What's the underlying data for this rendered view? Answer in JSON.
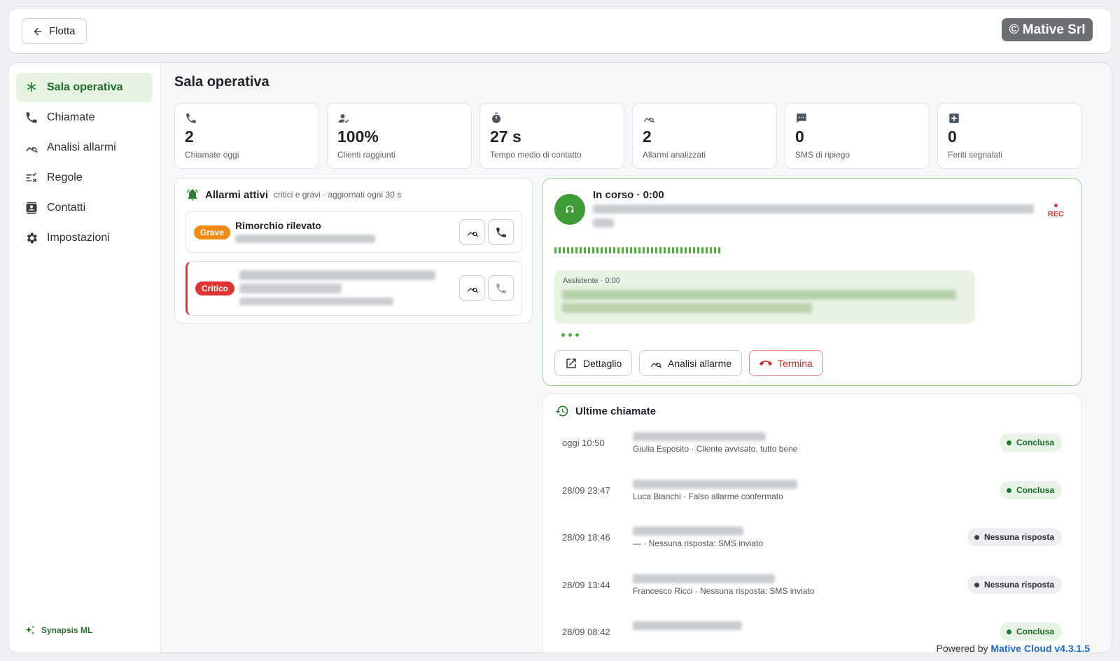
{
  "topbar": {
    "back_label": "Flotta",
    "brand_badge": "© Mative Srl"
  },
  "sidebar": {
    "items": [
      {
        "label": "Sala operativa",
        "icon": "asterisk-icon",
        "active": true
      },
      {
        "label": "Chiamate",
        "icon": "phone-icon"
      },
      {
        "label": "Analisi allarmi",
        "icon": "chart-search-icon"
      },
      {
        "label": "Regole",
        "icon": "rules-icon"
      },
      {
        "label": "Contatti",
        "icon": "contacts-icon"
      },
      {
        "label": "Impostazioni",
        "icon": "gear-icon"
      }
    ],
    "footer_brand": "Synapsis ML"
  },
  "page": {
    "title": "Sala operativa"
  },
  "stats": [
    {
      "value": "2",
      "label": "Chiamate oggi",
      "icon": "phone-icon"
    },
    {
      "value": "100%",
      "label": "Clienti raggiunti",
      "icon": "user-check-icon"
    },
    {
      "value": "27 s",
      "label": "Tempo medio di contatto",
      "icon": "stopwatch-icon"
    },
    {
      "value": "2",
      "label": "Allarmi analizzati",
      "icon": "chart-search-icon"
    },
    {
      "value": "0",
      "label": "SMS di ripiego",
      "icon": "message-icon"
    },
    {
      "value": "0",
      "label": "Feriti segnalati",
      "icon": "medical-plus-icon"
    }
  ],
  "alarms": {
    "title": "Allarmi attivi",
    "subtitle": "critici e gravi · aggiornati ogni 30 s",
    "items": [
      {
        "severity": "Grave",
        "title": "Rimorchio rilevato"
      },
      {
        "severity": "Critico",
        "title": ""
      }
    ]
  },
  "call": {
    "status": "In corso · 0:00",
    "rec_label": "REC",
    "bubble_speaker": "Assistente · 0:00",
    "actions": {
      "detail": "Dettaglio",
      "analysis": "Analisi allarme",
      "end": "Termina"
    },
    "colors": {
      "accent": "#3d9c36",
      "danger": "#d93a3a"
    }
  },
  "recent": {
    "title": "Ultime chiamate",
    "rows": [
      {
        "time": "oggi 10:50",
        "sub": "Giulia Esposito · Cliente avvisato, tutto bene",
        "status": "Conclusa",
        "kind": "ok"
      },
      {
        "time": "28/09 23:47",
        "sub": "Luca Bianchi · Falso allarme confermato",
        "status": "Conclusa",
        "kind": "ok"
      },
      {
        "time": "28/09 18:46",
        "sub": "— · Nessuna risposta: SMS inviato",
        "status": "Nessuna risposta",
        "kind": "no"
      },
      {
        "time": "28/09 13:44",
        "sub": "Francesco Ricci · Nessuna risposta: SMS inviato",
        "status": "Nessuna risposta",
        "kind": "no"
      },
      {
        "time": "28/09 08:42",
        "sub": "",
        "status": "Conclusa",
        "kind": "ok"
      }
    ]
  },
  "footer": {
    "powered_prefix": "Powered by",
    "powered_brand": "Mative Cloud v4.3.1.5"
  }
}
